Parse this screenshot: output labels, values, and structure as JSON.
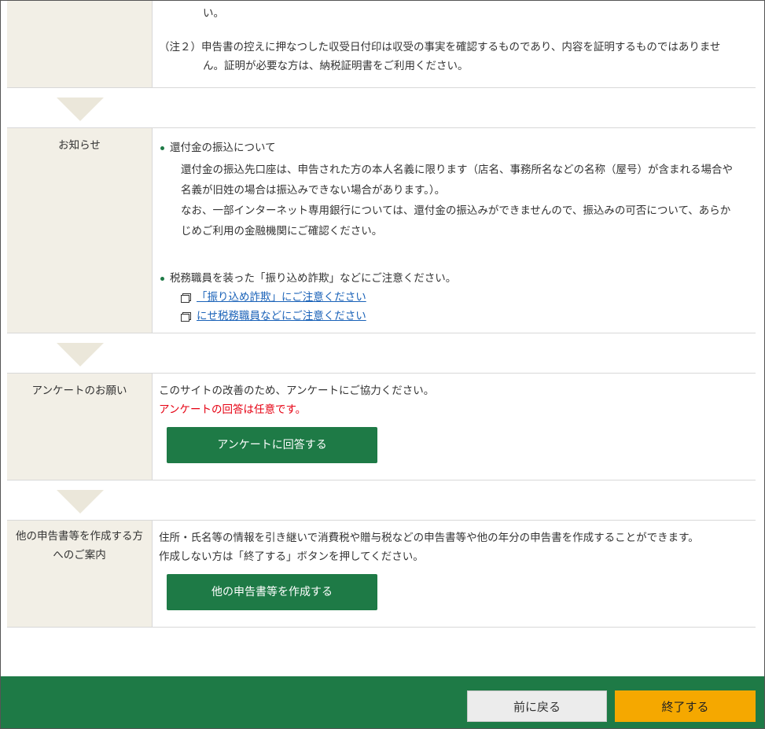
{
  "top_section": {
    "cont_line": "い。",
    "note2_line1": "（注２）申告書の控えに押なつした収受日付印は収受の事実を確認するものであり、内容を証明するものではありませ",
    "note2_line2": "ん。証明が必要な方は、納税証明書をご利用ください。"
  },
  "notice": {
    "label": "お知らせ",
    "bullet1_title": "還付金の振込について",
    "bullet1_lines": [
      "還付金の振込先口座は、申告された方の本人名義に限ります（店名、事務所名などの名称（屋号）が含まれる場合や",
      "名義が旧姓の場合は振込みできない場合があります。）。",
      "なお、一部インターネット専用銀行については、還付金の振込みができませんので、振込みの可否について、あらか",
      "じめご利用の金融機関にご確認ください。"
    ],
    "bullet2_title": "税務職員を装った「振り込め詐欺」などにご注意ください。",
    "links": [
      "「振り込め詐欺」にご注意ください",
      "にせ税務職員などにご注意ください"
    ]
  },
  "survey": {
    "label": "アンケートのお願い",
    "text": "このサイトの改善のため、アンケートにご協力ください。",
    "optional_text": "アンケートの回答は任意です。",
    "button": "アンケートに回答する"
  },
  "other": {
    "label_line1": "他の申告書等を作成する方",
    "label_line2": "へのご案内",
    "text1": "住所・氏名等の情報を引き継いで消費税や贈与税などの申告書等や他の年分の申告書を作成することができます。",
    "text2": "作成しない方は「終了する」ボタンを押してください。",
    "button": "他の申告書等を作成する"
  },
  "footer": {
    "back_label": "前に戻る",
    "end_label": "終了する"
  },
  "colors": {
    "primary_green": "#1e7a46",
    "accent_orange": "#f5a800",
    "warning_red": "#e60012",
    "link_blue": "#1a62b8"
  }
}
